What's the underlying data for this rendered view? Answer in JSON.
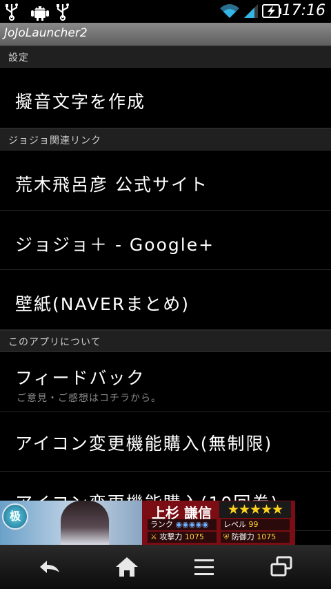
{
  "status_bar": {
    "time": "17:16",
    "icons": [
      "usb-icon",
      "android-debug-icon",
      "usb-icon",
      "wifi-icon",
      "signal-icon",
      "battery-charging-icon"
    ]
  },
  "title_bar": {
    "title": "JoJoLauncher2"
  },
  "sections": [
    {
      "label": "設定"
    },
    {
      "label": "ジョジョ関連リンク"
    },
    {
      "label": "このアプリについて"
    }
  ],
  "items": {
    "create_onomatopoeia": {
      "label": "擬音文字を作成"
    },
    "araki_site": {
      "label": "荒木飛呂彦 公式サイト"
    },
    "jojo_google_plus": {
      "label": "ジョジョ＋ - Google+"
    },
    "wallpaper": {
      "label": "壁紙(NAVERまとめ)"
    },
    "feedback": {
      "label": "フィードバック",
      "sublabel": "ご意見・ご感想はコチラから。"
    },
    "icon_unlimited": {
      "label": "アイコン変更機能購入(無制限)"
    },
    "icon_limited": {
      "label": "アイコン変更機能購入(10回券)"
    }
  },
  "ad": {
    "badge": "极",
    "name": "上杉 謙信",
    "stars": "★★★★★",
    "rank_label": "ランク",
    "level_label": "レベル",
    "level_value": "99",
    "attack_label": "攻撃力",
    "attack_value": "1075",
    "defense_label": "防御力",
    "defense_value": "1075"
  },
  "nav_bar": {
    "icons": [
      "back-icon",
      "home-icon",
      "menu-icon",
      "recent-apps-icon"
    ]
  },
  "colors": {
    "background": "#000000",
    "section": "#202020",
    "title_bar": "#6e6e6e",
    "ad_red": "#7a0e14"
  }
}
